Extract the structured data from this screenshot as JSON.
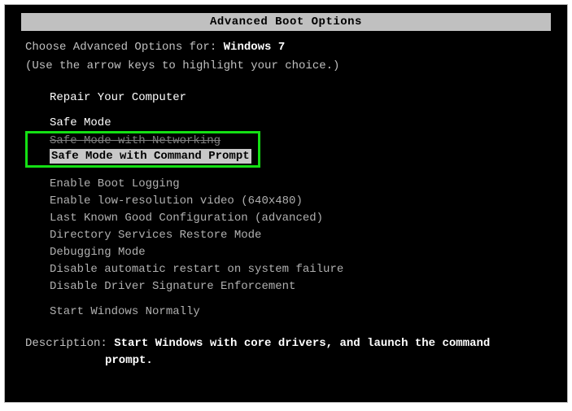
{
  "title": "Advanced Boot Options",
  "instruction": {
    "line1_prefix": "Choose Advanced Options for: ",
    "os_name": "Windows 7",
    "line2": "(Use the arrow keys to highlight your choice.)"
  },
  "options": {
    "repair": "Repair Your Computer",
    "safe_mode": "Safe Mode",
    "safe_mode_net": "Safe Mode with Networking",
    "safe_mode_cmd": "Safe Mode with Command Prompt",
    "boot_logging": "Enable Boot Logging",
    "low_res": "Enable low-resolution video (640x480)",
    "last_known": "Last Known Good Configuration (advanced)",
    "dsrm": "Directory Services Restore Mode",
    "debugging": "Debugging Mode",
    "no_auto_restart": "Disable automatic restart on system failure",
    "no_sig_enforce": "Disable Driver Signature Enforcement",
    "start_normally": "Start Windows Normally"
  },
  "description": {
    "label": "Description: ",
    "text_line1": "Start Windows with core drivers, and launch the command",
    "text_line2": "prompt."
  }
}
